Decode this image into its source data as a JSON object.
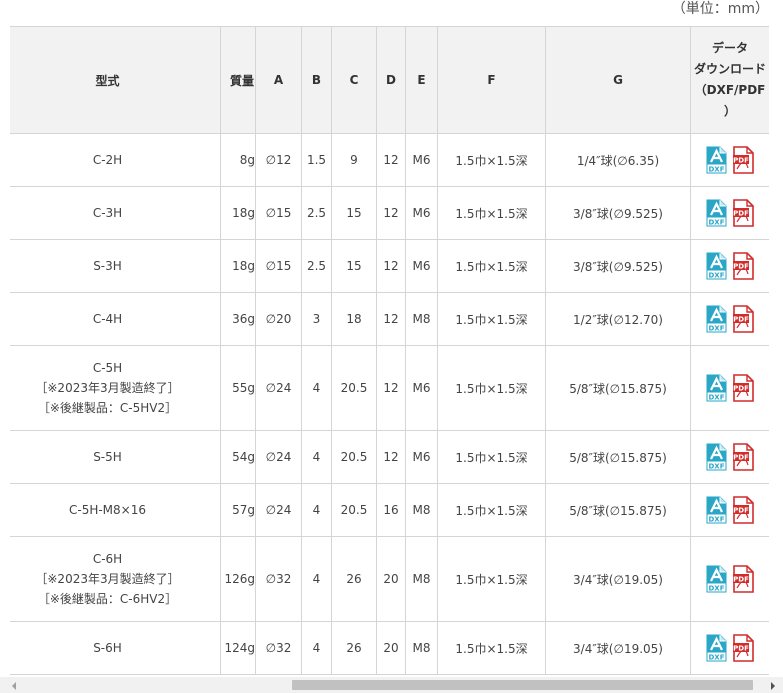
{
  "unit_label": "（単位：mm）",
  "headers": {
    "model": "型式",
    "mass": "質量",
    "a": "A",
    "b": "B",
    "c": "C",
    "d": "D",
    "e": "E",
    "f": "F",
    "g": "G",
    "download_line1": "データ",
    "download_line2": "ダウンロード",
    "download_line3": "（DXF/PDF",
    "download_line4": "）"
  },
  "icons": {
    "dxf_label": "DXF",
    "pdf_label": "PDF",
    "dxf_color": "#2aa7c7",
    "pdf_color": "#d12c2c"
  },
  "rows": [
    {
      "model": [
        "C-2H"
      ],
      "mass": "8g",
      "a": "∅12",
      "b": "1.5",
      "c": "9",
      "d": "12",
      "e": "M6",
      "f": "1.5巾×1.5深",
      "g": "1/4″球(∅6.35)"
    },
    {
      "model": [
        "C-3H"
      ],
      "mass": "18g",
      "a": "∅15",
      "b": "2.5",
      "c": "15",
      "d": "12",
      "e": "M6",
      "f": "1.5巾×1.5深",
      "g": "3/8″球(∅9.525)"
    },
    {
      "model": [
        "S-3H"
      ],
      "mass": "18g",
      "a": "∅15",
      "b": "2.5",
      "c": "15",
      "d": "12",
      "e": "M6",
      "f": "1.5巾×1.5深",
      "g": "3/8″球(∅9.525)"
    },
    {
      "model": [
        "C-4H"
      ],
      "mass": "36g",
      "a": "∅20",
      "b": "3",
      "c": "18",
      "d": "12",
      "e": "M8",
      "f": "1.5巾×1.5深",
      "g": "1/2″球(∅12.70)"
    },
    {
      "model": [
        "C-5H",
        "［※2023年3月製造終了］",
        "［※後継製品：C-5HV2］"
      ],
      "mass": "55g",
      "a": "∅24",
      "b": "4",
      "c": "20.5",
      "d": "12",
      "e": "M6",
      "f": "1.5巾×1.5深",
      "g": "5/8″球(∅15.875)"
    },
    {
      "model": [
        "S-5H"
      ],
      "mass": "54g",
      "a": "∅24",
      "b": "4",
      "c": "20.5",
      "d": "12",
      "e": "M6",
      "f": "1.5巾×1.5深",
      "g": "5/8″球(∅15.875)"
    },
    {
      "model": [
        "C-5H-M8×16"
      ],
      "mass": "57g",
      "a": "∅24",
      "b": "4",
      "c": "20.5",
      "d": "16",
      "e": "M8",
      "f": "1.5巾×1.5深",
      "g": "5/8″球(∅15.875)"
    },
    {
      "model": [
        "C-6H",
        "［※2023年3月製造終了］",
        "［※後継製品：C-6HV2］"
      ],
      "mass": "126g",
      "a": "∅32",
      "b": "4",
      "c": "26",
      "d": "20",
      "e": "M8",
      "f": "1.5巾×1.5深",
      "g": "3/4″球(∅19.05)"
    },
    {
      "model": [
        "S-6H"
      ],
      "mass": "124g",
      "a": "∅32",
      "b": "4",
      "c": "26",
      "d": "20",
      "e": "M8",
      "f": "1.5巾×1.5深",
      "g": "3/4″球(∅19.05)"
    }
  ]
}
